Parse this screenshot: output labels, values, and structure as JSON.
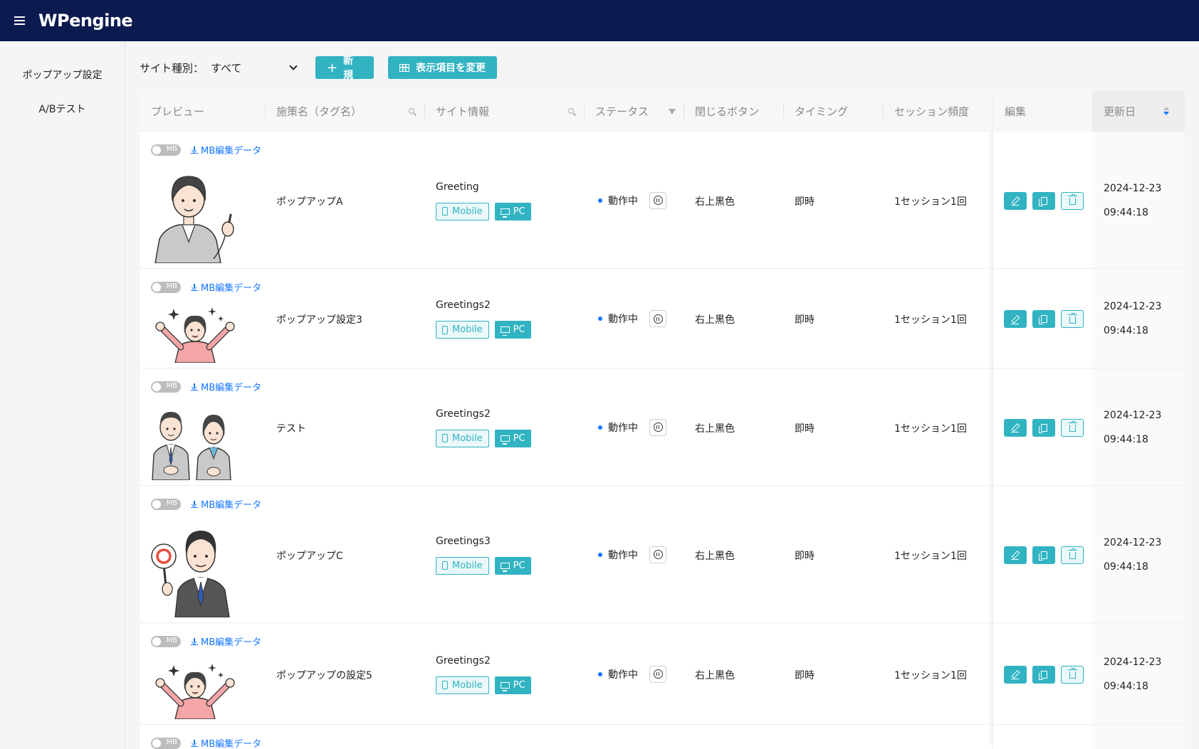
{
  "app": {
    "brand": "WPengine"
  },
  "sidebar": {
    "items": [
      {
        "label": "ポップアップ設定"
      },
      {
        "label": "A/Bテスト"
      }
    ]
  },
  "toolbar": {
    "site_type_label": "サイト種別：",
    "site_type_value": "すべて",
    "new_label": "新規",
    "columns_label": "表示項目を変更"
  },
  "table": {
    "headers": {
      "preview": "プレビュー",
      "name": "施策名（タグ名）",
      "site": "サイト情報",
      "status": "ステータス",
      "close": "閉じるボタン",
      "timing": "タイミング",
      "session": "セッション頻度",
      "edit": "編集",
      "updated": "更新日"
    },
    "rows": [
      {
        "toggle": "MB",
        "mb_link": "MB編集データ",
        "illustration": "woman-pointing",
        "name": "ポップアップA",
        "site": "Greeting",
        "tag_mobile": "Mobile",
        "tag_pc": "PC",
        "status": "動作中",
        "close": "右上黒色",
        "timing": "即時",
        "session": "1セッション1回",
        "date": "2024-12-23",
        "time": "09:44:18"
      },
      {
        "toggle": "MB",
        "mb_link": "MB編集データ",
        "illustration": "woman-cheering",
        "name": "ポップアップ設定3",
        "site": "Greetings2",
        "tag_mobile": "Mobile",
        "tag_pc": "PC",
        "status": "動作中",
        "close": "右上黒色",
        "timing": "即時",
        "session": "1セッション1回",
        "date": "2024-12-23",
        "time": "09:44:18"
      },
      {
        "toggle": "MB",
        "mb_link": "MB編集データ",
        "illustration": "business-pair",
        "name": "テスト",
        "site": "Greetings2",
        "tag_mobile": "Mobile",
        "tag_pc": "PC",
        "status": "動作中",
        "close": "右上黒色",
        "timing": "即時",
        "session": "1セッション1回",
        "date": "2024-12-23",
        "time": "09:44:18"
      },
      {
        "toggle": "MB",
        "mb_link": "MB編集データ",
        "illustration": "man-circle-sign",
        "name": "ポップアップC",
        "site": "Greetings3",
        "tag_mobile": "Mobile",
        "tag_pc": "PC",
        "status": "動作中",
        "close": "右上黒色",
        "timing": "即時",
        "session": "1セッション1回",
        "date": "2024-12-23",
        "time": "09:44:18"
      },
      {
        "toggle": "MB",
        "mb_link": "MB編集データ",
        "illustration": "woman-cheering",
        "name": "ポップアップの設定5",
        "site": "Greetings2",
        "tag_mobile": "Mobile",
        "tag_pc": "PC",
        "status": "動作中",
        "close": "右上黒色",
        "timing": "即時",
        "session": "1セッション1回",
        "date": "2024-12-23",
        "time": "09:44:18"
      },
      {
        "toggle": "MB",
        "mb_link": "MB編集データ"
      }
    ]
  },
  "colors": {
    "topbar": "#0b1a4f",
    "accent": "#31b3c2",
    "link": "#1677ff"
  }
}
